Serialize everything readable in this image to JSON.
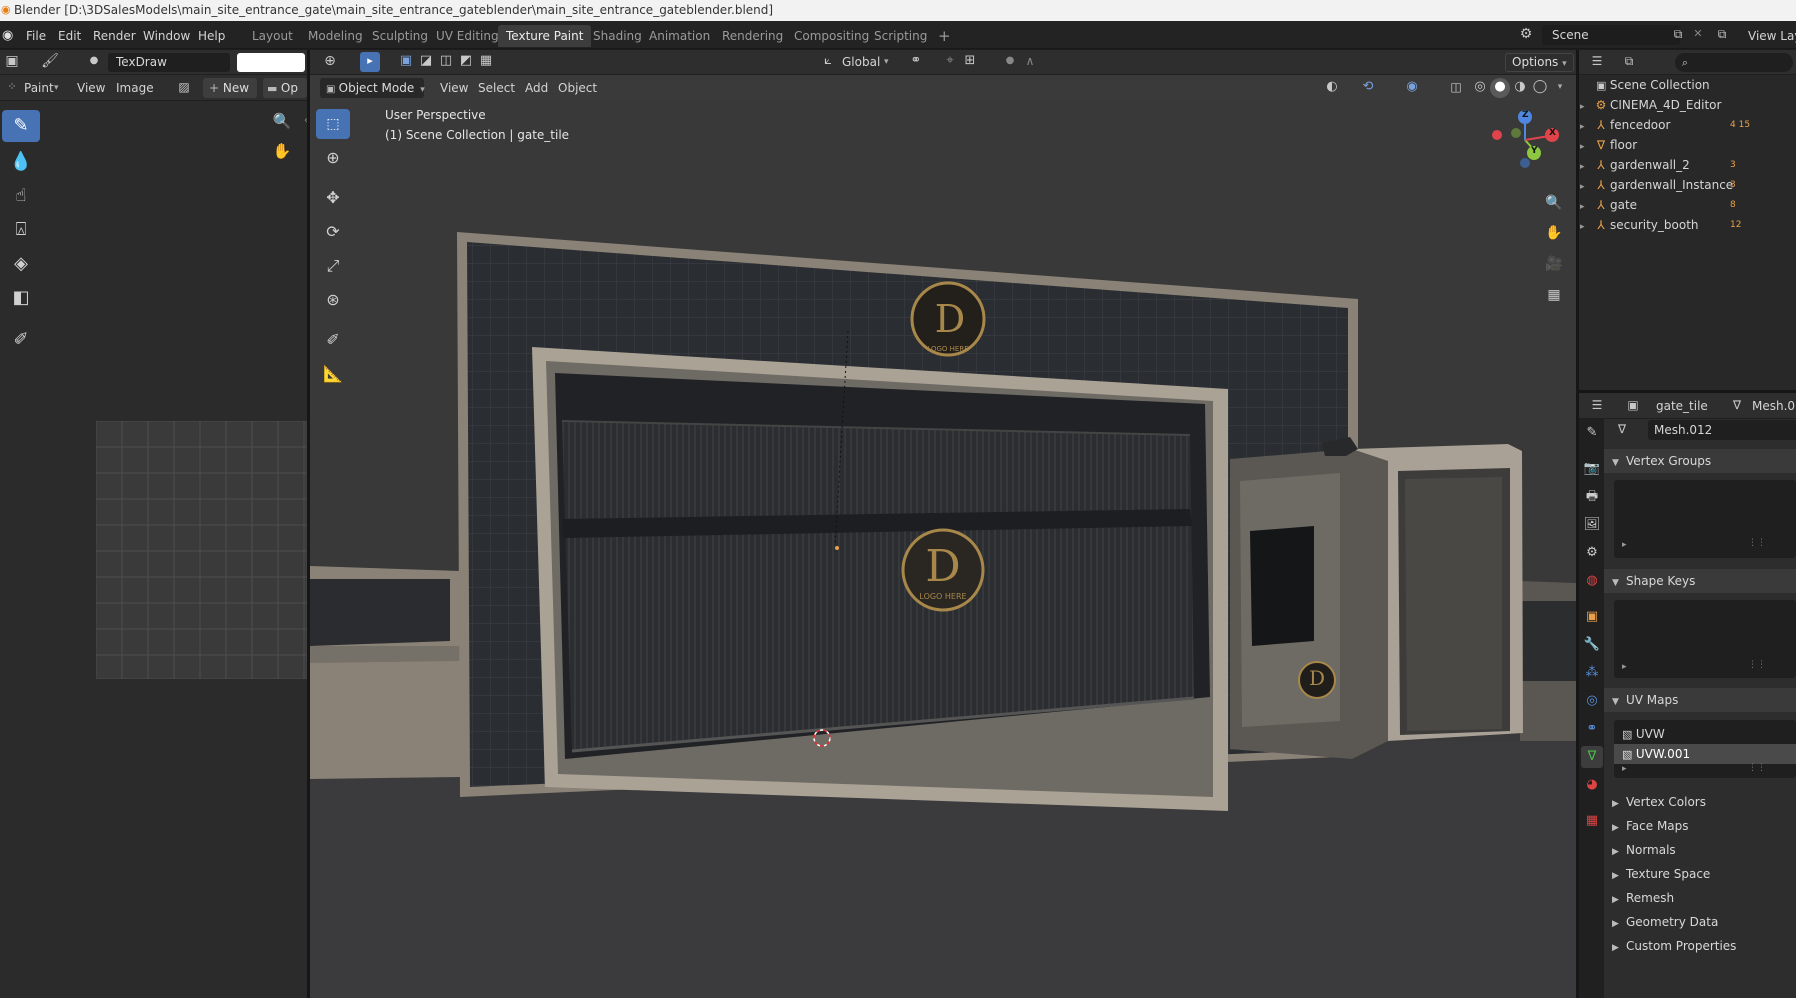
{
  "window": {
    "title": "Blender [D:\\3DSalesModels\\main_site_entrance_gate\\main_site_entrance_gateblender\\main_site_entrance_gateblender.blend]"
  },
  "menu": {
    "file": "File",
    "edit": "Edit",
    "render": "Render",
    "window": "Window",
    "help": "Help"
  },
  "workspaces": [
    "Layout",
    "Modeling",
    "Sculpting",
    "UV Editing",
    "Texture Paint",
    "Shading",
    "Animation",
    "Rendering",
    "Compositing",
    "Scripting"
  ],
  "active_workspace": "Texture Paint",
  "scene": {
    "name": "Scene",
    "view_layer": "View Lay"
  },
  "image_editor": {
    "brush_name": "TexDraw",
    "mode": "Paint",
    "view": "View",
    "image": "Image",
    "new": "New",
    "open": "Op"
  },
  "viewport": {
    "mode": "Object Mode",
    "view": "View",
    "select": "Select",
    "add": "Add",
    "object": "Object",
    "orientation": "Global",
    "options": "Options",
    "overlay_line1": "User Perspective",
    "overlay_line2": "(1) Scene Collection | gate_tile",
    "logo_letter": "D",
    "logo_text": "LOGO HERE"
  },
  "gizmo": {
    "z": "Z",
    "y": "Y",
    "x": "X"
  },
  "outliner": {
    "root": "Scene Collection",
    "items": [
      {
        "name": "CINEMA_4D_Editor",
        "badge": ""
      },
      {
        "name": "fencedoor",
        "badge": "4 15"
      },
      {
        "name": "floor",
        "badge": ""
      },
      {
        "name": "gardenwall_2",
        "badge": "3"
      },
      {
        "name": "gardenwall_Instance",
        "badge": "3"
      },
      {
        "name": "gate",
        "badge": "8"
      },
      {
        "name": "security_booth",
        "badge": "12"
      }
    ]
  },
  "properties": {
    "object_name": "gate_tile",
    "mesh_name": "Mesh.01",
    "data_name": "Mesh.012",
    "vertex_groups": "Vertex Groups",
    "shape_keys": "Shape Keys",
    "uv_maps": "UV Maps",
    "uv_list": [
      "UVW",
      "UVW.001"
    ],
    "active_uv": "UVW.001",
    "collapsed_panels": [
      "Vertex Colors",
      "Face Maps",
      "Normals",
      "Texture Space",
      "Remesh",
      "Geometry Data",
      "Custom Properties"
    ]
  },
  "colors": {
    "accent": "#4772b3",
    "active_tab": "#3d3d3d",
    "selection_orange": "#e8a14a"
  }
}
